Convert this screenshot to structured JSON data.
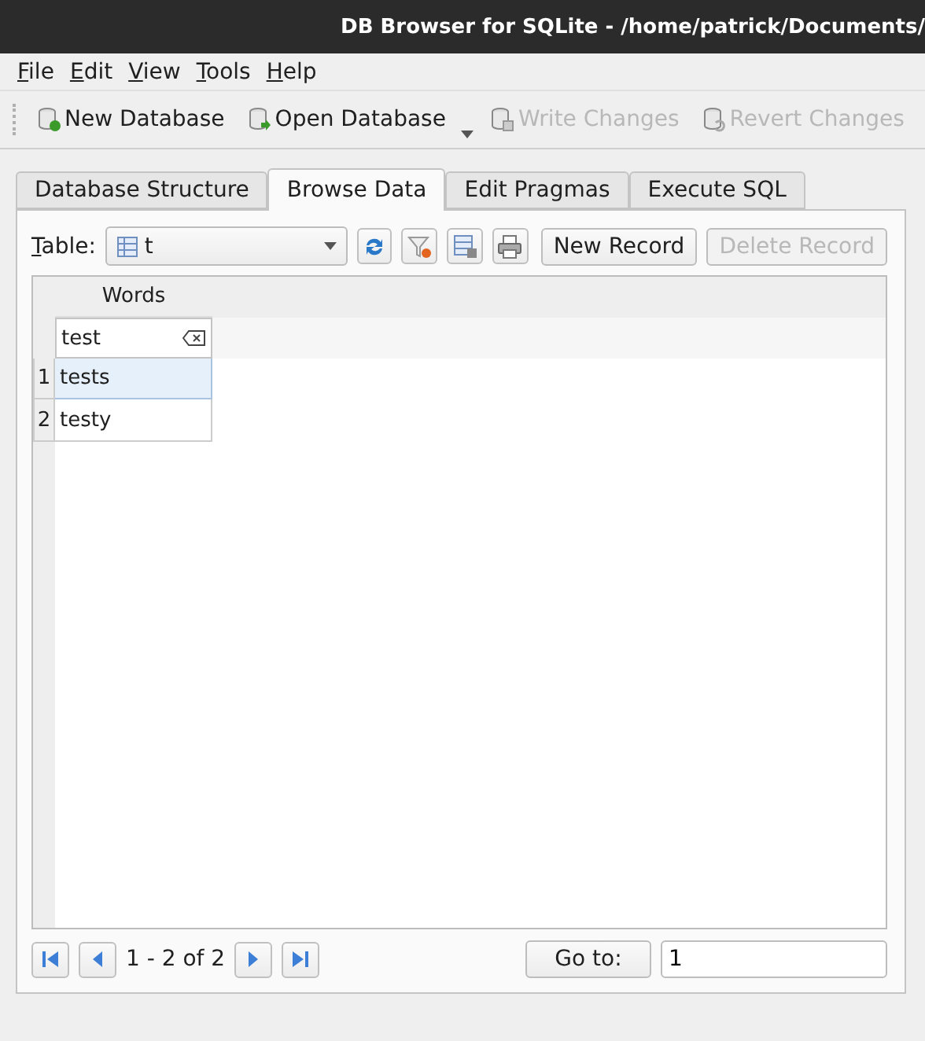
{
  "window": {
    "title": "DB Browser for SQLite - /home/patrick/Documents/"
  },
  "menu": [
    "File",
    "Edit",
    "View",
    "Tools",
    "Help"
  ],
  "toolbar": [
    {
      "label": "New Database",
      "disabled": false,
      "kind": "new"
    },
    {
      "label": "Open Database",
      "disabled": false,
      "kind": "open"
    },
    {
      "label": "Write Changes",
      "disabled": true,
      "kind": "write"
    },
    {
      "label": "Revert Changes",
      "disabled": true,
      "kind": "revert"
    }
  ],
  "tabs": [
    {
      "label": "Database Structure",
      "selected": false
    },
    {
      "label": "Browse Data",
      "selected": true
    },
    {
      "label": "Edit Pragmas",
      "selected": false
    },
    {
      "label": "Execute SQL",
      "selected": false
    }
  ],
  "browse": {
    "table_label": "Table:",
    "table_value": "t",
    "new_record": "New Record",
    "delete_record": {
      "label": "Delete Record",
      "disabled": true
    }
  },
  "table": {
    "columns": [
      "Words"
    ],
    "filter": "test",
    "rows": [
      {
        "number": "1",
        "cells": [
          "tests"
        ],
        "selected": true
      },
      {
        "number": "2",
        "cells": [
          "testy"
        ],
        "selected": false
      }
    ]
  },
  "pager": {
    "range": "1 - 2 of 2",
    "goto_button": "Go to:",
    "goto_value": "1"
  }
}
